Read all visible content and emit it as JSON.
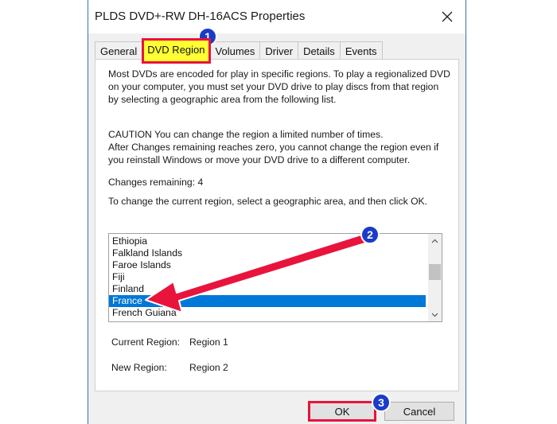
{
  "window": {
    "title": "PLDS DVD+-RW DH-16ACS Properties"
  },
  "tabs": [
    {
      "label": "General"
    },
    {
      "label": "DVD Region"
    },
    {
      "label": "Volumes"
    },
    {
      "label": "Driver"
    },
    {
      "label": "Details"
    },
    {
      "label": "Events"
    }
  ],
  "content": {
    "intro": "Most DVDs are encoded for play in specific regions. To play a regionalized DVD on your computer, you must set your DVD drive to play discs from that region by selecting a geographic area from the following list.",
    "caution_line1": "CAUTION   You can change the region a limited number of times.",
    "caution_line2": "After Changes remaining reaches zero, you cannot change the region even if you reinstall Windows or move your DVD drive to a different computer.",
    "changes_remaining": "Changes remaining: 4",
    "instruction": "To change the current region, select a geographic area, and then click OK."
  },
  "region_list": {
    "items": [
      "Ethiopia",
      "Falkland Islands",
      "Faroe Islands",
      "Fiji",
      "Finland",
      "France",
      "French Guiana"
    ],
    "selected": "France"
  },
  "region_info": {
    "current_label": "Current Region:",
    "current_value": "Region 1",
    "new_label": "New Region:",
    "new_value": "Region 2"
  },
  "buttons": {
    "ok": "OK",
    "cancel": "Cancel"
  },
  "annotations": {
    "step1": "1",
    "step2": "2",
    "step3": "3",
    "badge_color": "#1a3cc8",
    "highlight_color": "#e8143c",
    "arrow_color": "#e8143c"
  },
  "icons": {
    "close": "close-icon",
    "scroll_up": "chevron-up-icon",
    "scroll_down": "chevron-down-icon"
  }
}
